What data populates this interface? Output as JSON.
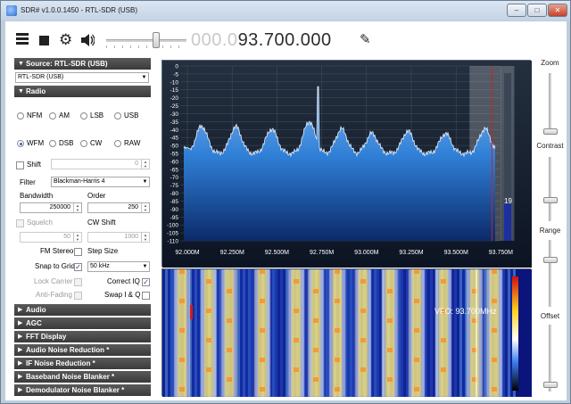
{
  "window": {
    "title": "SDR# v1.0.0.1450 - RTL-SDR (USB)",
    "minimize_glyph": "–",
    "maximize_glyph": "□",
    "close_glyph": "✕"
  },
  "toolbar": {
    "frequency_leading": "000.0",
    "frequency_main": "93.700.000",
    "volume_level_fraction": 0.62
  },
  "source": {
    "header": "Source: RTL-SDR (USB)",
    "device": "RTL-SDR (USB)"
  },
  "radio": {
    "header": "Radio",
    "modes": [
      "NFM",
      "AM",
      "LSB",
      "USB",
      "WFM",
      "DSB",
      "CW",
      "RAW"
    ],
    "selected_mode": "WFM",
    "shift_label": "Shift",
    "shift_value": "0",
    "filter_label": "Filter",
    "filter_value": "Blackman-Harris 4",
    "bandwidth_label": "Bandwidth",
    "bandwidth_value": "250000",
    "order_label": "Order",
    "order_value": "250",
    "squelch_label": "Squelch",
    "squelch_value": "50",
    "cw_shift_label": "CW Shift",
    "cw_shift_value": "1000",
    "fm_stereo_label": "FM Stereo",
    "step_size_label": "Step Size",
    "snap_to_grid_label": "Snap to Grid",
    "step_value": "50 kHz",
    "lock_carrier_label": "Lock Carrier",
    "correct_iq_label": "Correct IQ",
    "anti_fading_label": "Anti-Fading",
    "swap_iq_label": "Swap I & Q"
  },
  "panels": [
    "Audio",
    "AGC",
    "FFT Display",
    "Audio Noise Reduction *",
    "IF Noise Reduction *",
    "Baseband Noise Blanker *",
    "Demodulator Noise Blanker *"
  ],
  "spectrum": {
    "y_ticks": [
      "0",
      "-5",
      "-10",
      "-15",
      "-20",
      "-25",
      "-30",
      "-35",
      "-40",
      "-45",
      "-50",
      "-55",
      "-60",
      "-65",
      "-70",
      "-75",
      "-80",
      "-85",
      "-90",
      "-95",
      "-100",
      "-105",
      "-110"
    ],
    "x_ticks": [
      "92.000M",
      "92.250M",
      "92.500M",
      "92.750M",
      "93.000M",
      "93.250M",
      "93.500M",
      "93.750M"
    ],
    "level_readout": "19"
  },
  "waterfall": {
    "vfo_label": "VFO: 93.700MHz"
  },
  "side": {
    "zoom_label": "Zoom",
    "contrast_label": "Contrast",
    "range_label": "Range",
    "offset_label": "Offset"
  },
  "colors": {
    "header_bg": "#4a4a4a",
    "spectrum_bg": "#0c1423",
    "spectrum_fill": "#2f7fd6",
    "vfo_line": "#d02020",
    "accent": "#2a64c8"
  },
  "icons": {
    "menu": "hamburger-icon",
    "stop": "stop-icon",
    "settings": "gear-icon",
    "audio": "speaker-icon",
    "pin": "pin-icon"
  }
}
